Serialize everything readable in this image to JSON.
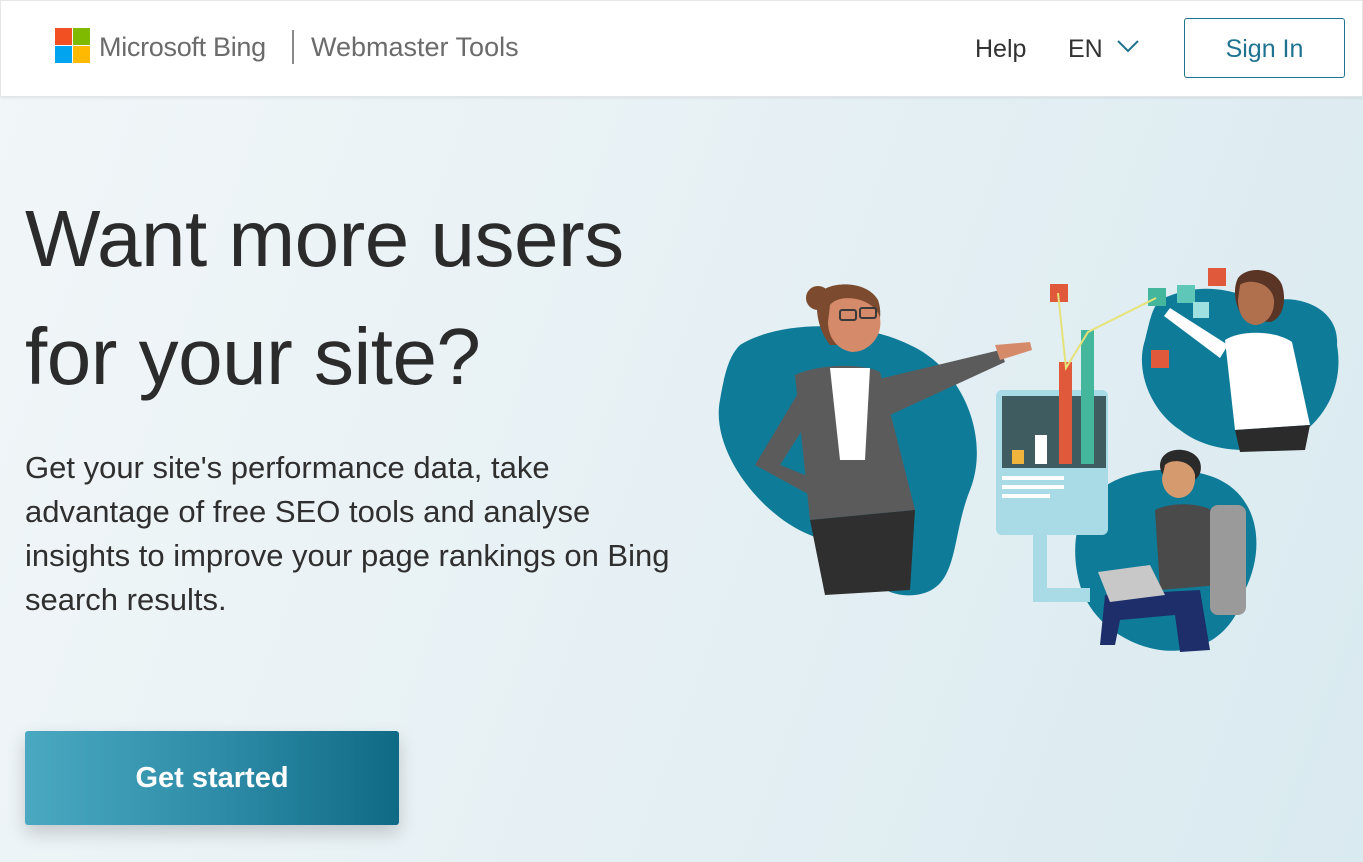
{
  "header": {
    "brand": "Microsoft Bing",
    "product": "Webmaster Tools",
    "help_label": "Help",
    "language": "EN",
    "signin_label": "Sign In"
  },
  "hero": {
    "headline_line1": "Want more users",
    "headline_line2": "for your site?",
    "description": "Get your site's performance data, take advantage of free SEO tools and analyse insights to improve your page rankings on Bing search results.",
    "cta_label": "Get started"
  },
  "colors": {
    "accent": "#1f7391",
    "cta_start": "#4aa9c1",
    "cta_end": "#0f6a85",
    "logo_red": "#f25022",
    "logo_green": "#7fba00",
    "logo_blue": "#00a4ef",
    "logo_yellow": "#ffb900"
  },
  "icons": {
    "logo": "microsoft-logo-icon",
    "language_dropdown": "chevron-down-icon"
  }
}
